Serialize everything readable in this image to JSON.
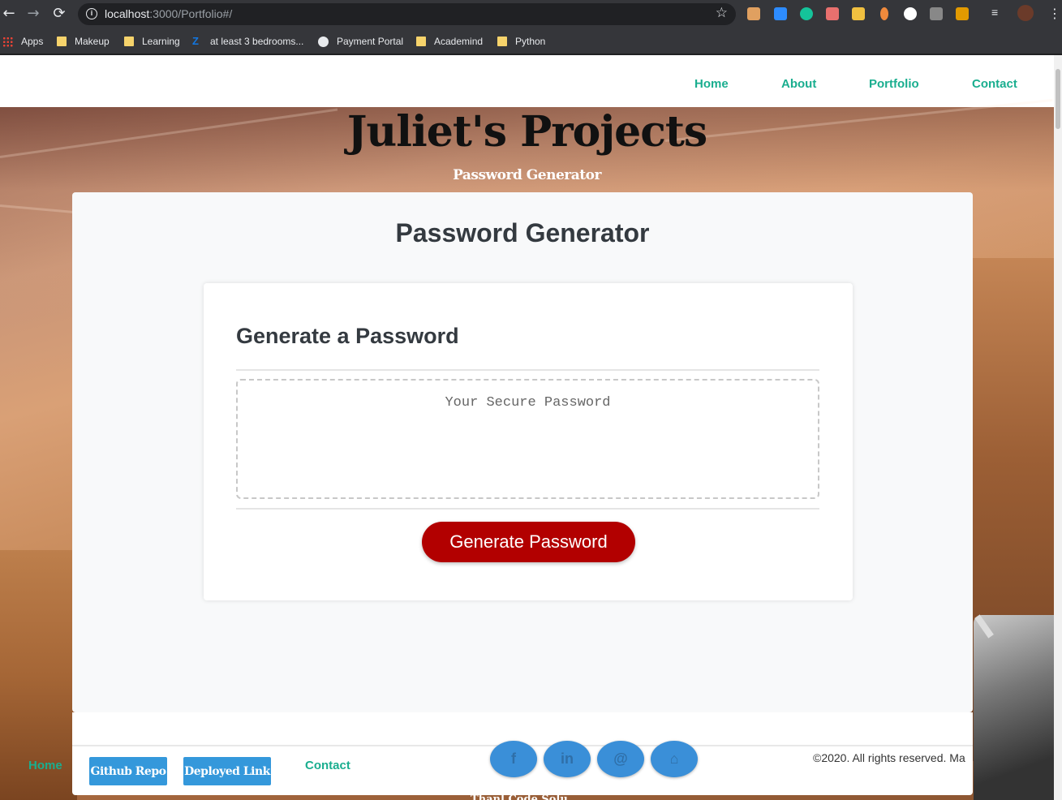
{
  "browser": {
    "url_host": "localhost",
    "url_path": ":3000/Portfolio#/",
    "bookmarks": [
      "Apps",
      "Makeup",
      "Learning",
      "at least 3 bedrooms...",
      "Payment Portal",
      "Academind",
      "Python"
    ]
  },
  "site_nav": {
    "home": "Home",
    "about": "About",
    "portfolio": "Portfolio",
    "contact": "Contact"
  },
  "hero": {
    "title": "Juliet's Projects",
    "subtitle": "Password Generator"
  },
  "app": {
    "title": "Password Generator",
    "card_header": "Generate a Password",
    "password_placeholder": "Your Secure Password",
    "generate_label": "Generate Password"
  },
  "project_links": {
    "github": "Github Repo",
    "deployed": "Deployed Link"
  },
  "footer": {
    "home": "Home",
    "contact": "Contact",
    "copyright": "©2020. All rights reserved. Ma",
    "social": [
      "f",
      "in",
      "@",
      "⌂"
    ],
    "bottom_text": "Thanl Code Solu"
  },
  "colors": {
    "accent": "#1aae8f",
    "button": "#b20000",
    "project_button": "#3498db"
  }
}
